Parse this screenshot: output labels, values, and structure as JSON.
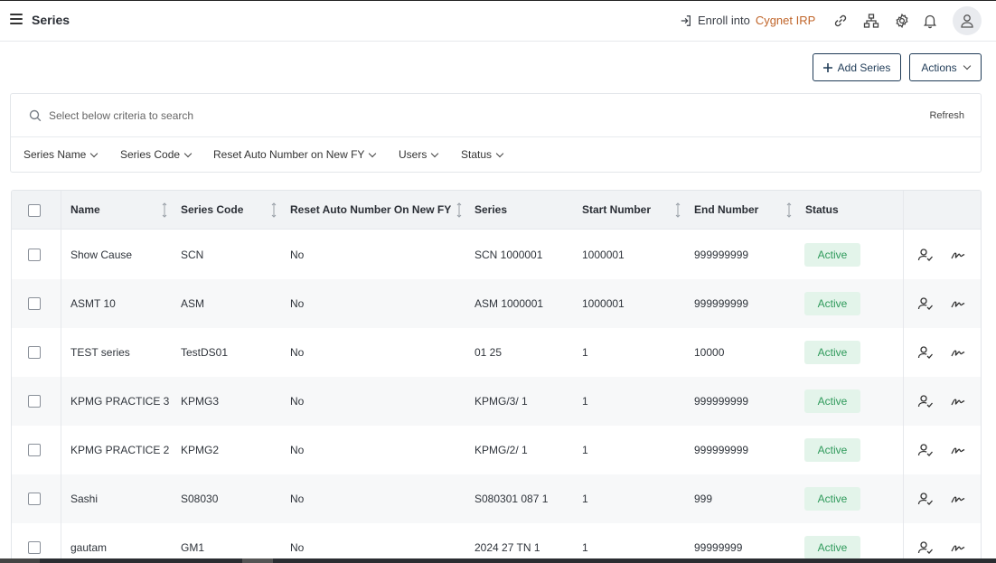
{
  "header": {
    "title": "Series",
    "enroll_prefix": "Enroll into",
    "enroll_brand": "Cygnet IRP",
    "icons": [
      "login-icon",
      "link-icon",
      "sitemap-icon",
      "gear-icon",
      "bell-icon",
      "user-icon"
    ]
  },
  "toolbar": {
    "add_label": "Add Series",
    "actions_label": "Actions"
  },
  "search": {
    "placeholder": "Select below criteria to search",
    "refresh_label": "Refresh",
    "filters": [
      "Series Name",
      "Series Code",
      "Reset Auto Number on New FY",
      "Users",
      "Status"
    ]
  },
  "table": {
    "columns": [
      "Name",
      "Series Code",
      "Reset Auto Number On New FY",
      "Series",
      "Start Number",
      "End Number",
      "Status"
    ],
    "rows": [
      {
        "name": "Show Cause",
        "code": "SCN",
        "reset": "No",
        "series": "SCN 1000001",
        "start": "1000001",
        "end": "999999999",
        "status": "Active"
      },
      {
        "name": "ASMT 10",
        "code": "ASM",
        "reset": "No",
        "series": "ASM 1000001",
        "start": "1000001",
        "end": "999999999",
        "status": "Active"
      },
      {
        "name": "TEST series",
        "code": "TestDS01",
        "reset": "No",
        "series": "01 25",
        "start": "1",
        "end": "10000",
        "status": "Active"
      },
      {
        "name": "KPMG PRACTICE 3",
        "code": "KPMG3",
        "reset": "No",
        "series": "KPMG/3/ 1",
        "start": "1",
        "end": "999999999",
        "status": "Active"
      },
      {
        "name": "KPMG PRACTICE 2",
        "code": "KPMG2",
        "reset": "No",
        "series": "KPMG/2/ 1",
        "start": "1",
        "end": "999999999",
        "status": "Active"
      },
      {
        "name": "Sashi",
        "code": "S08030",
        "reset": "No",
        "series": "S080301 087 1",
        "start": "1",
        "end": "999",
        "status": "Active"
      },
      {
        "name": "gautam",
        "code": "GM1",
        "reset": "No",
        "series": "2024 27 TN 1",
        "start": "1",
        "end": "99999999",
        "status": "Active"
      }
    ]
  },
  "colors": {
    "primary": "#1f3b57",
    "brand": "#c0652a",
    "active_bg": "#e3f4ea",
    "active_text": "#2f9a5b",
    "header_row_bg": "#f1f3f5"
  }
}
